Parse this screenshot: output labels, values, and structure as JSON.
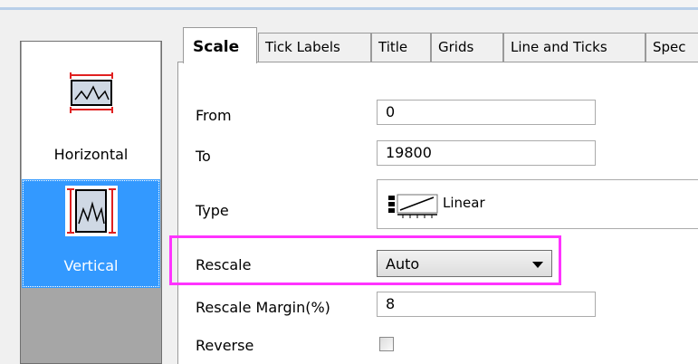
{
  "axes_panel": {
    "items": [
      {
        "label": "Horizontal",
        "icon": "horizontal-axis-icon",
        "selected": false
      },
      {
        "label": "Vertical",
        "icon": "vertical-axis-icon",
        "selected": true
      }
    ]
  },
  "tabs": [
    {
      "label": "Scale",
      "active": true
    },
    {
      "label": "Tick Labels",
      "active": false
    },
    {
      "label": "Title",
      "active": false
    },
    {
      "label": "Grids",
      "active": false
    },
    {
      "label": "Line and Ticks",
      "active": false
    },
    {
      "label": "Spec",
      "active": false
    }
  ],
  "scale": {
    "from": {
      "label": "From",
      "value": "0"
    },
    "to": {
      "label": "To",
      "value": "19800"
    },
    "type": {
      "label": "Type",
      "value": "Linear",
      "icon": "linear-scale-icon"
    },
    "rescale": {
      "label": "Rescale",
      "value": "Auto"
    },
    "rescale_margin": {
      "label": "Rescale Margin(%)",
      "value": "8"
    },
    "reverse": {
      "label": "Reverse",
      "checked": false
    }
  },
  "colors": {
    "selection": "#3399ff",
    "highlight": "#ff33ff"
  }
}
